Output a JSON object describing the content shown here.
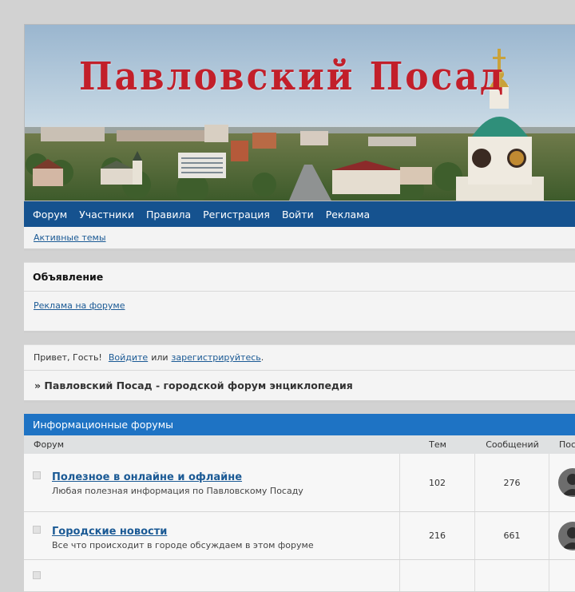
{
  "site": {
    "banner_title": "Павловский Посад"
  },
  "nav": {
    "items": [
      {
        "label": "Форум"
      },
      {
        "label": "Участники"
      },
      {
        "label": "Правила"
      },
      {
        "label": "Регистрация"
      },
      {
        "label": "Войти"
      },
      {
        "label": "Реклама"
      }
    ],
    "active_topics": "Активные темы"
  },
  "announcement": {
    "heading": "Объявление",
    "link": "Реклама на форуме"
  },
  "welcome": {
    "greeting": "Привет, Гость!",
    "login_link": "Войдите",
    "or_text": "или",
    "register_link": "зарегистрируйтесь",
    "end": "."
  },
  "breadcrumb": {
    "text": "» Павловский Посад - городской форум энциклопедия"
  },
  "forums": {
    "category": "Информационные форумы",
    "columns": {
      "forum": "Форум",
      "topics": "Тем",
      "posts": "Сообщений",
      "last": "Последнее сообщение"
    },
    "rows": [
      {
        "title": "Полезное в онлайне и офлайне",
        "desc": "Любая полезная информация по Павловскому Посаду",
        "topics": "102",
        "posts": "276"
      },
      {
        "title": "Городские новости",
        "desc": "Все что происходит в городе обсуждаем в этом форуме",
        "topics": "216",
        "posts": "661"
      }
    ]
  },
  "icons": {
    "status": "forum-status-icon",
    "avatar": "user-avatar-icon"
  },
  "colors": {
    "nav_bg": "#15528f",
    "category_bg": "#1e73c4",
    "title_red": "#c21f2a",
    "link": "#1b5a95"
  }
}
